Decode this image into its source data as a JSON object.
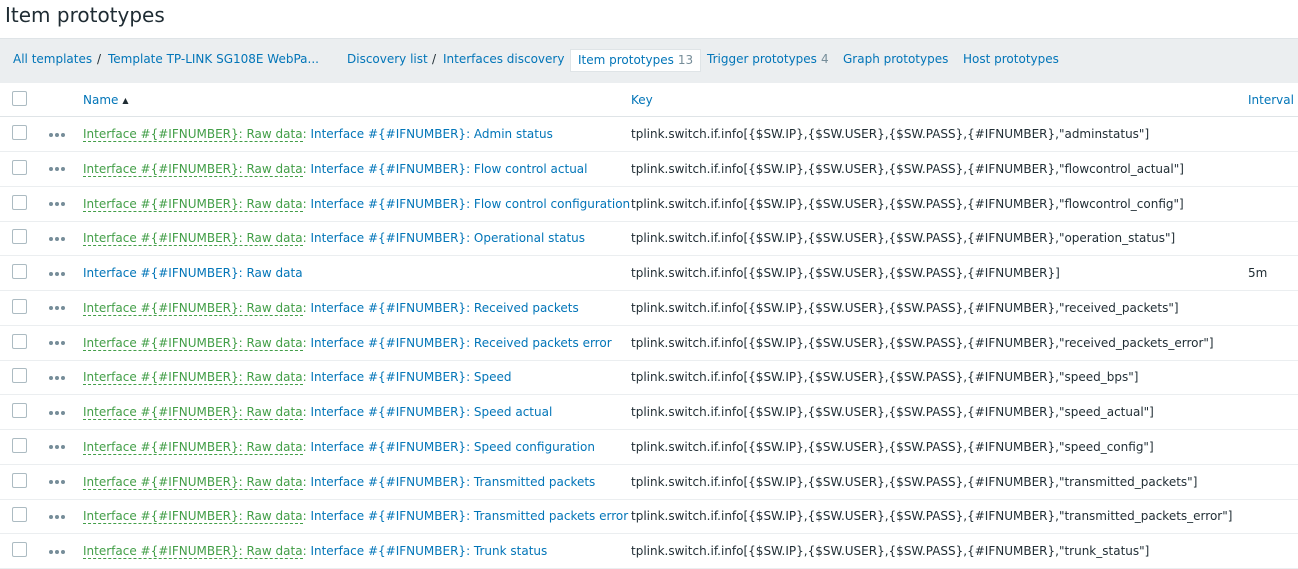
{
  "page": {
    "title": "Item prototypes"
  },
  "nav": {
    "all_templates": "All templates",
    "sep": "/",
    "template": "Template TP-LINK SG108E WebPa...",
    "discovery_list": "Discovery list",
    "discovery_rule": "Interfaces discovery",
    "item_prototypes": "Item prototypes",
    "item_prototypes_count": "13",
    "trigger_prototypes": "Trigger prototypes",
    "trigger_prototypes_count": "4",
    "graph_prototypes": "Graph prototypes",
    "host_prototypes": "Host prototypes"
  },
  "table": {
    "headers": {
      "name": "Name",
      "sort_indicator": "▲",
      "key": "Key",
      "interval": "Interval"
    },
    "rows": [
      {
        "parent": "Interface #{#IFNUMBER}: Raw data",
        "name": "Interface #{#IFNUMBER}: Admin status",
        "key": "tplink.switch.if.info[{$SW.IP},{$SW.USER},{$SW.PASS},{#IFNUMBER},\"adminstatus\"]",
        "interval": ""
      },
      {
        "parent": "Interface #{#IFNUMBER}: Raw data",
        "name": "Interface #{#IFNUMBER}: Flow control actual",
        "key": "tplink.switch.if.info[{$SW.IP},{$SW.USER},{$SW.PASS},{#IFNUMBER},\"flowcontrol_actual\"]",
        "interval": ""
      },
      {
        "parent": "Interface #{#IFNUMBER}: Raw data",
        "name": "Interface #{#IFNUMBER}: Flow control configuration",
        "key": "tplink.switch.if.info[{$SW.IP},{$SW.USER},{$SW.PASS},{#IFNUMBER},\"flowcontrol_config\"]",
        "interval": ""
      },
      {
        "parent": "Interface #{#IFNUMBER}: Raw data",
        "name": "Interface #{#IFNUMBER}: Operational status",
        "key": "tplink.switch.if.info[{$SW.IP},{$SW.USER},{$SW.PASS},{#IFNUMBER},\"operation_status\"]",
        "interval": ""
      },
      {
        "parent": "",
        "name": "Interface #{#IFNUMBER}: Raw data",
        "key": "tplink.switch.if.info[{$SW.IP},{$SW.USER},{$SW.PASS},{#IFNUMBER}]",
        "interval": "5m"
      },
      {
        "parent": "Interface #{#IFNUMBER}: Raw data",
        "name": "Interface #{#IFNUMBER}: Received packets",
        "key": "tplink.switch.if.info[{$SW.IP},{$SW.USER},{$SW.PASS},{#IFNUMBER},\"received_packets\"]",
        "interval": ""
      },
      {
        "parent": "Interface #{#IFNUMBER}: Raw data",
        "name": "Interface #{#IFNUMBER}: Received packets error",
        "key": "tplink.switch.if.info[{$SW.IP},{$SW.USER},{$SW.PASS},{#IFNUMBER},\"received_packets_error\"]",
        "interval": ""
      },
      {
        "parent": "Interface #{#IFNUMBER}: Raw data",
        "name": "Interface #{#IFNUMBER}: Speed",
        "key": "tplink.switch.if.info[{$SW.IP},{$SW.USER},{$SW.PASS},{#IFNUMBER},\"speed_bps\"]",
        "interval": ""
      },
      {
        "parent": "Interface #{#IFNUMBER}: Raw data",
        "name": "Interface #{#IFNUMBER}: Speed actual",
        "key": "tplink.switch.if.info[{$SW.IP},{$SW.USER},{$SW.PASS},{#IFNUMBER},\"speed_actual\"]",
        "interval": ""
      },
      {
        "parent": "Interface #{#IFNUMBER}: Raw data",
        "name": "Interface #{#IFNUMBER}: Speed configuration",
        "key": "tplink.switch.if.info[{$SW.IP},{$SW.USER},{$SW.PASS},{#IFNUMBER},\"speed_config\"]",
        "interval": ""
      },
      {
        "parent": "Interface #{#IFNUMBER}: Raw data",
        "name": "Interface #{#IFNUMBER}: Transmitted packets",
        "key": "tplink.switch.if.info[{$SW.IP},{$SW.USER},{$SW.PASS},{#IFNUMBER},\"transmitted_packets\"]",
        "interval": ""
      },
      {
        "parent": "Interface #{#IFNUMBER}: Raw data",
        "name": "Interface #{#IFNUMBER}: Transmitted packets error",
        "key": "tplink.switch.if.info[{$SW.IP},{$SW.USER},{$SW.PASS},{#IFNUMBER},\"transmitted_packets_error\"]",
        "interval": ""
      },
      {
        "parent": "Interface #{#IFNUMBER}: Raw data",
        "name": "Interface #{#IFNUMBER}: Trunk status",
        "key": "tplink.switch.if.info[{$SW.IP},{$SW.USER},{$SW.PASS},{#IFNUMBER},\"trunk_status\"]",
        "interval": ""
      }
    ]
  },
  "colors": {
    "link": "#0275b8",
    "parent_link": "#429e47",
    "nav_bg": "#ebeef0"
  },
  "icons": {
    "row_menu": "more-dots-icon",
    "sort": "sort-ascending-icon"
  }
}
